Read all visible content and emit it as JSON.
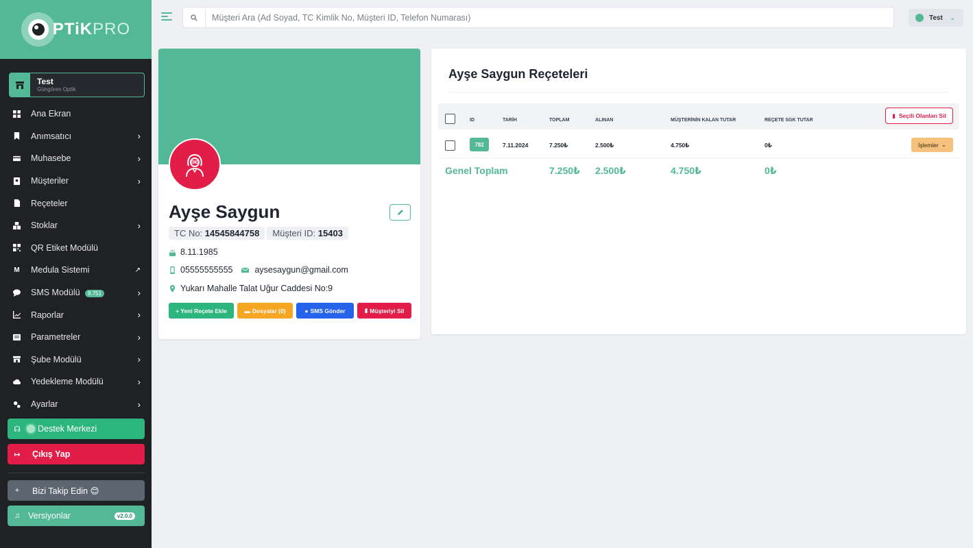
{
  "brand": {
    "logo_bold": "PTiK",
    "logo_light": "PRO"
  },
  "user_card": {
    "name": "Test",
    "branch": "Güngören Optik"
  },
  "sidebar": {
    "items": [
      {
        "label": "Ana Ekran"
      },
      {
        "label": "Anımsatıcı"
      },
      {
        "label": "Muhasebe"
      },
      {
        "label": "Müşteriler"
      },
      {
        "label": "Reçeteler"
      },
      {
        "label": "Stoklar"
      },
      {
        "label": "QR Etiket Modülü"
      },
      {
        "label": "Medula Sistemi"
      },
      {
        "label": "SMS Modülü",
        "badge": "8.751"
      },
      {
        "label": "Raporlar"
      },
      {
        "label": "Parametreler"
      },
      {
        "label": "Şube Modülü"
      },
      {
        "label": "Yedekleme Modülü"
      },
      {
        "label": "Ayarlar"
      }
    ],
    "support": "Destek Merkezi",
    "logout": "Çıkış Yap",
    "follow": "Bizi Takip Edin 😊",
    "versions": "Versiyonlar",
    "version_badge": "v2.0.0"
  },
  "search": {
    "placeholder": "Müşteri Ara (Ad Soyad, TC Kimlik No, Müşteri ID, Telefon Numarası)"
  },
  "top_user": {
    "name": "Test"
  },
  "customer": {
    "name": "Ayşe Saygun",
    "tc_label": "TC No:",
    "tc_value": "14545844758",
    "id_label": "Müşteri ID:",
    "id_value": "15403",
    "birthdate": "8.11.1985",
    "phone": "05555555555",
    "email": "aysesaygun@gmail.com",
    "address": "Yukarı Mahalle Talat Uğur Caddesi No:9",
    "actions": {
      "new_recipe": "+ Yeni Reçete Ekle",
      "files": "Dosyalar (0)",
      "sms": "SMS Gönder",
      "delete": "Müşteriyi Sil"
    }
  },
  "recipes": {
    "title": "Ayşe Saygun Reçeteleri",
    "delete_selected": "Seçili Olanları Sil",
    "columns": [
      "ID",
      "TARİH",
      "TOPLAM",
      "ALINAN",
      "MÜŞTERİNİN KALAN TUTAR",
      "REÇETE SGK TUTAR"
    ],
    "rows": [
      {
        "id": "782",
        "date": "7.11.2024",
        "total": "7.250₺",
        "received": "2.500₺",
        "remaining": "4.750₺",
        "sgk": "0₺",
        "action": "İşlemler"
      }
    ],
    "totals": {
      "label": "Genel Toplam",
      "total": "7.250₺",
      "received": "2.500₺",
      "remaining": "4.750₺",
      "sgk": "0₺"
    }
  },
  "colors": {
    "accent": "#52b895",
    "danger": "#e11d48",
    "warning": "#f5a623",
    "info": "#2563eb",
    "sidebar": "#1f2124"
  }
}
